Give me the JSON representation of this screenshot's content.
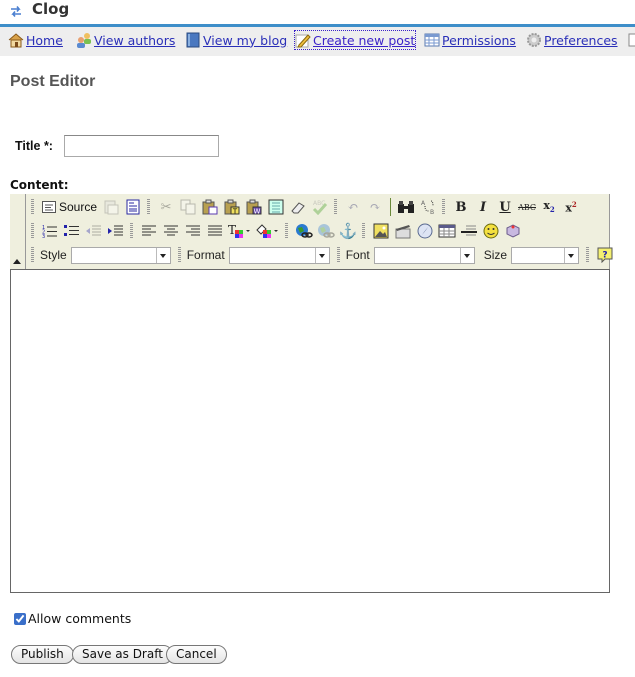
{
  "app": {
    "title": "Clog",
    "logo_icon": "sync-arrows-icon"
  },
  "nav": {
    "items": [
      {
        "label": "Home",
        "icon": "home-icon",
        "active": false
      },
      {
        "label": "View authors",
        "icon": "users-icon",
        "active": false
      },
      {
        "label": "View my blog",
        "icon": "book-icon",
        "active": false
      },
      {
        "label": "Create new post",
        "icon": "pencil-icon",
        "active": true
      },
      {
        "label": "Permissions",
        "icon": "table-icon",
        "active": false
      },
      {
        "label": "Preferences",
        "icon": "gear-icon",
        "active": false
      }
    ]
  },
  "page": {
    "title": "Post Editor"
  },
  "form": {
    "title_label": "Title *:",
    "title_value": "",
    "content_label": "Content:",
    "allow_comments_label": "Allow comments",
    "allow_comments_checked": true
  },
  "editor": {
    "source_label": "Source",
    "style_label": "Style",
    "format_label": "Format",
    "font_label": "Font",
    "size_label": "Size",
    "style_value": "",
    "format_value": "",
    "font_value": "",
    "size_value": "",
    "content": ""
  },
  "buttons": {
    "publish": "Publish",
    "save_draft": "Save as Draft",
    "cancel": "Cancel"
  }
}
